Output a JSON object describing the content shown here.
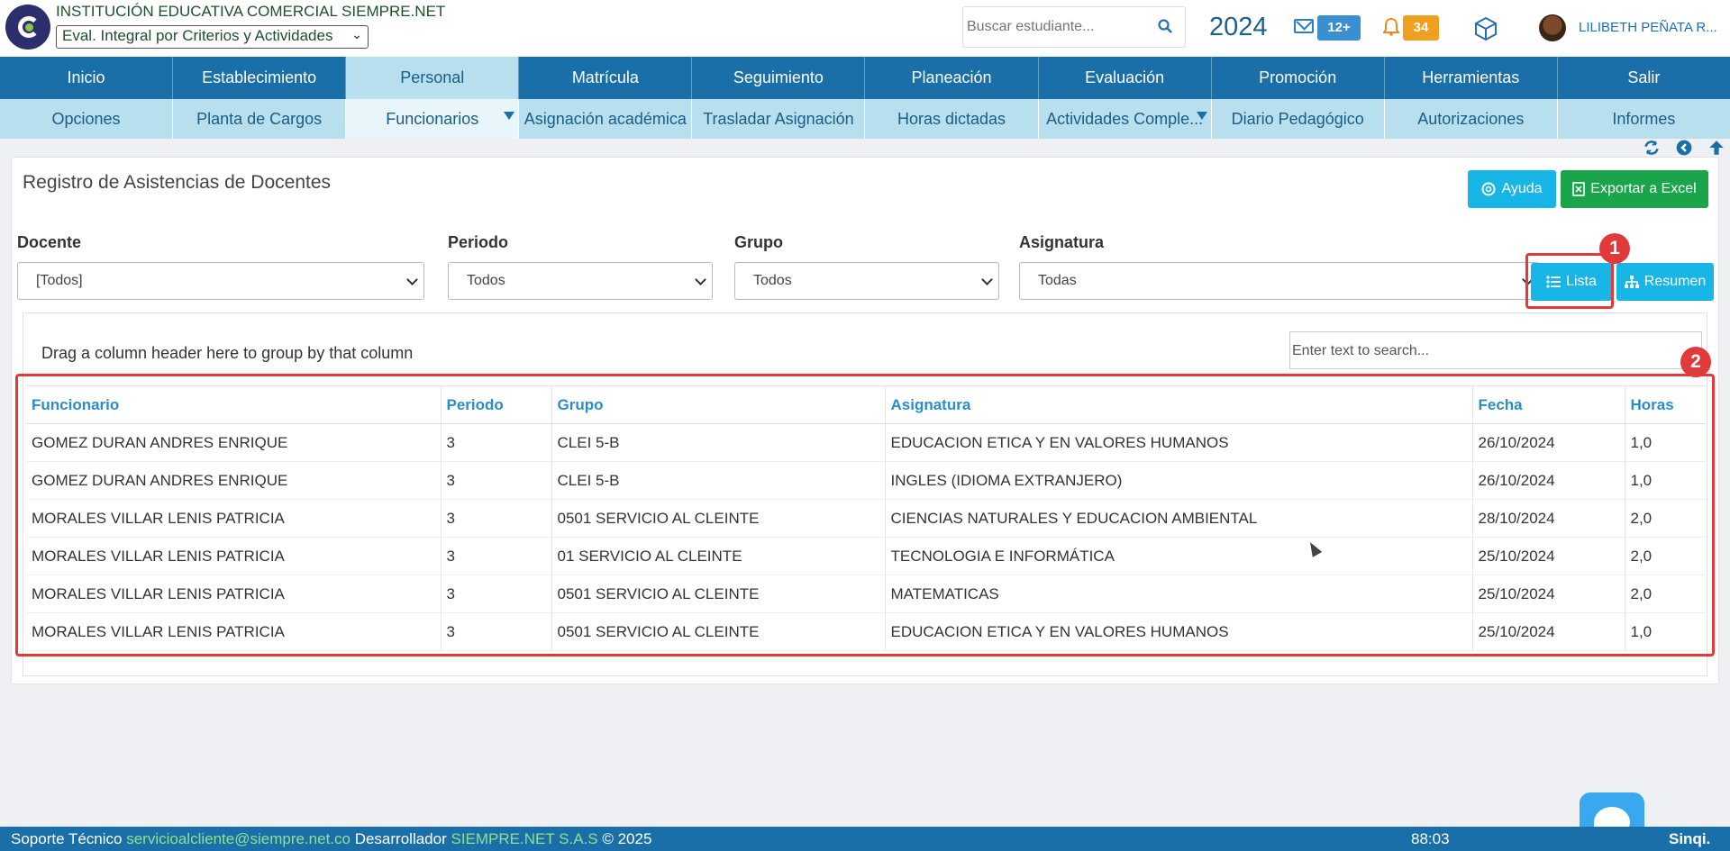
{
  "header": {
    "school_name": "INSTITUCIÓN EDUCATIVA COMERCIAL SIEMPRE.NET",
    "eval_mode": "Eval. Integral por Criterios y Actividades",
    "search_placeholder": "Buscar estudiante...",
    "year": "2024",
    "messages_count": "12+",
    "notifications_count": "34",
    "user_name": "LILIBETH PEÑATA R..."
  },
  "main_nav": [
    {
      "label": "Inicio"
    },
    {
      "label": "Establecimiento"
    },
    {
      "label": "Personal"
    },
    {
      "label": "Matrícula"
    },
    {
      "label": "Seguimiento"
    },
    {
      "label": "Planeación"
    },
    {
      "label": "Evaluación"
    },
    {
      "label": "Promoción"
    },
    {
      "label": "Herramientas"
    },
    {
      "label": "Salir"
    }
  ],
  "sub_nav": [
    {
      "label": "Opciones"
    },
    {
      "label": "Planta de Cargos"
    },
    {
      "label": "Funcionarios"
    },
    {
      "label": "Asignación académica"
    },
    {
      "label": "Trasladar Asignación"
    },
    {
      "label": "Horas dictadas"
    },
    {
      "label": "Actividades Comple..."
    },
    {
      "label": "Diario Pedagógico"
    },
    {
      "label": "Autorizaciones"
    },
    {
      "label": "Informes"
    }
  ],
  "panel": {
    "title": "Registro de Asistencias de Docentes",
    "help_label": "Ayuda",
    "excel_label": "Exportar a Excel",
    "filters": {
      "docente_label": "Docente",
      "docente_value": "[Todos]",
      "periodo_label": "Periodo",
      "periodo_value": "Todos",
      "grupo_label": "Grupo",
      "grupo_value": "Todos",
      "asignatura_label": "Asignatura",
      "asignatura_value": "Todas"
    },
    "lista_label": "Lista",
    "resumen_label": "Resumen",
    "marker_1": "1",
    "marker_2": "2",
    "group_hint": "Drag a column header here to group by that column",
    "grid_search_placeholder": "Enter text to search...",
    "columns": {
      "funcionario": "Funcionario",
      "periodo": "Periodo",
      "grupo": "Grupo",
      "asignatura": "Asignatura",
      "fecha": "Fecha",
      "horas": "Horas"
    },
    "rows": [
      {
        "funcionario": "GOMEZ DURAN ANDRES ENRIQUE",
        "periodo": "3",
        "grupo": "CLEI 5-B",
        "asignatura": "EDUCACION ETICA Y EN VALORES HUMANOS",
        "fecha": "26/10/2024",
        "horas": "1,0"
      },
      {
        "funcionario": "GOMEZ DURAN ANDRES ENRIQUE",
        "periodo": "3",
        "grupo": "CLEI 5-B",
        "asignatura": "INGLES (IDIOMA EXTRANJERO)",
        "fecha": "26/10/2024",
        "horas": "1,0"
      },
      {
        "funcionario": "MORALES VILLAR LENIS PATRICIA",
        "periodo": "3",
        "grupo": "0501 SERVICIO AL CLEINTE",
        "asignatura": "CIENCIAS NATURALES Y EDUCACION AMBIENTAL",
        "fecha": "28/10/2024",
        "horas": "2,0"
      },
      {
        "funcionario": "MORALES VILLAR LENIS PATRICIA",
        "periodo": "3",
        "grupo": "01 SERVICIO AL CLEINTE",
        "asignatura": "TECNOLOGIA E INFORMÁTICA",
        "fecha": "25/10/2024",
        "horas": "2,0"
      },
      {
        "funcionario": "MORALES VILLAR LENIS PATRICIA",
        "periodo": "3",
        "grupo": "0501 SERVICIO AL CLEINTE",
        "asignatura": "MATEMATICAS",
        "fecha": "25/10/2024",
        "horas": "2,0"
      },
      {
        "funcionario": "MORALES VILLAR LENIS PATRICIA",
        "periodo": "3",
        "grupo": "0501 SERVICIO AL CLEINTE",
        "asignatura": "EDUCACION ETICA Y EN VALORES HUMANOS",
        "fecha": "25/10/2024",
        "horas": "1,0"
      }
    ]
  },
  "footer": {
    "support_label": "Soporte Técnico",
    "support_email": "servicioalcliente@siempre.net.co",
    "dev_label": "Desarrollador",
    "dev_name": "SIEMPRE.NET S.A.S",
    "copyright": "© 2025",
    "timer": "88:03",
    "brand": "Sinqi."
  },
  "colors": {
    "nav_blue": "#1a6fa8",
    "subnav_light": "#b8dfee",
    "accent_cyan": "#17b6e6",
    "excel_green": "#1aa54a",
    "highlight_red": "#e03a3a"
  }
}
